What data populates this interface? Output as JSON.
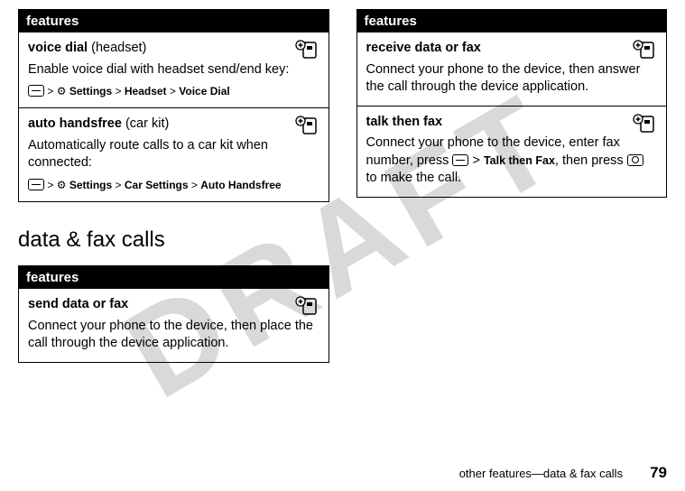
{
  "watermark": "DRAFT",
  "left": {
    "table1": {
      "header": "features",
      "row1": {
        "title": "voice dial",
        "paren": "(headset)",
        "desc": "Enable voice dial with headset send/end key:",
        "path1": "Settings",
        "path2": "Headset",
        "path3": "Voice Dial"
      },
      "row2": {
        "title": "auto handsfree",
        "paren": "(car kit)",
        "desc": "Automatically route calls to a car kit when connected:",
        "path1": "Settings",
        "path2": "Car Settings",
        "path3": "Auto Handsfree"
      }
    },
    "section_title": "data & fax calls",
    "table2": {
      "header": "features",
      "row1": {
        "title": "send data or fax",
        "desc": "Connect your phone to the device, then place the call through the device application."
      }
    }
  },
  "right": {
    "table1": {
      "header": "features",
      "row1": {
        "title": "receive data or fax",
        "desc": "Connect your phone to the device, then answer the call through the device application."
      },
      "row2": {
        "title": "talk then fax",
        "desc_a": "Connect your phone to the device, enter fax number, press ",
        "path1": "Talk then Fax",
        "desc_b": ", then press ",
        "desc_c": " to make the call."
      }
    }
  },
  "footer": {
    "text": "other features—data & fax calls",
    "page": "79"
  },
  "gt": ">"
}
